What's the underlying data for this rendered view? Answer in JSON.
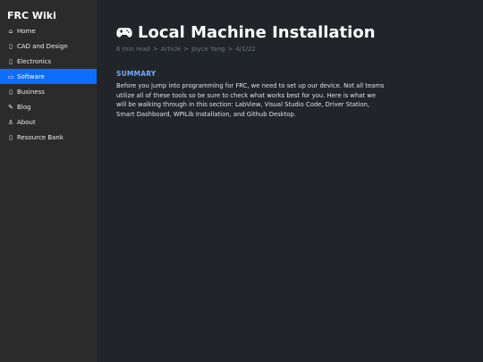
{
  "sidebar": {
    "brand": "FRC Wiki",
    "items": [
      {
        "label": "Home",
        "icon": "home-icon",
        "glyph": "⌂",
        "active": false
      },
      {
        "label": "CAD and Design",
        "icon": "cad-icon",
        "glyph": "▯",
        "active": false
      },
      {
        "label": "Electronics",
        "icon": "electronics-icon",
        "glyph": "▯",
        "active": false
      },
      {
        "label": "Software",
        "icon": "monitor-icon",
        "glyph": "▭",
        "active": true
      },
      {
        "label": "Business",
        "icon": "business-icon",
        "glyph": "▯",
        "active": false
      },
      {
        "label": "Blog",
        "icon": "tag-icon",
        "glyph": "✎",
        "active": false
      },
      {
        "label": "About",
        "icon": "anchor-icon",
        "glyph": "⚓",
        "active": false
      },
      {
        "label": "Resource Bank",
        "icon": "resource-icon",
        "glyph": "▯",
        "active": false
      }
    ]
  },
  "main": {
    "title": "Local Machine Installation",
    "title_icon": "gamepad-icon",
    "meta": {
      "read_time": "6 min read",
      "section": "Article",
      "author": "Joyce Yang",
      "date": "4/1/22",
      "separator": ">"
    },
    "summary_heading": "SUMMARY",
    "summary_text": "Before you jump into programming for FRC, we need to set up our device. Not all teams utilize all of these tools so be sure to check what works best for you. Here is what we will be walking through in this section: LabView, Visual Studio Code, Driver Station, Smart Dashboard, WPILib Installation, and Github Desktop."
  },
  "colors": {
    "sidebar_bg": "#2b2b2b",
    "main_bg": "#212529",
    "active": "#0d6efd",
    "summary_heading": "#6ea8fe"
  }
}
